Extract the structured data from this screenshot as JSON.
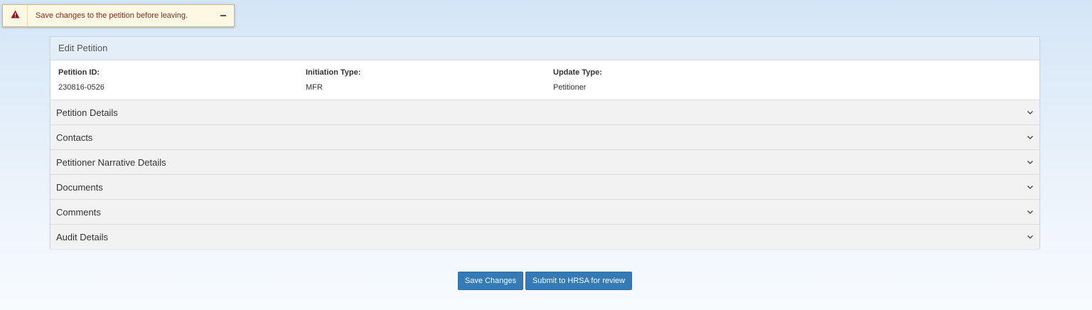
{
  "alert": {
    "message": "Save changes to the petition before leaving.",
    "icon": "warning-triangle-icon",
    "close_icon": "minimize-icon",
    "text_color": "#8a2a1a",
    "background": "#fcf8e3"
  },
  "panel": {
    "title": "Edit Petition",
    "fields": [
      {
        "label": "Petition ID:",
        "value": "230816-0526"
      },
      {
        "label": "Initiation Type:",
        "value": "MFR"
      },
      {
        "label": "Update Type:",
        "value": "Petitioner"
      }
    ],
    "sections": [
      {
        "title": "Petition Details"
      },
      {
        "title": "Contacts"
      },
      {
        "title": "Petitioner Narrative Details"
      },
      {
        "title": "Documents"
      },
      {
        "title": "Comments"
      },
      {
        "title": "Audit Details"
      }
    ]
  },
  "actions": {
    "save_label": "Save Changes",
    "submit_label": "Submit to HRSA for review",
    "button_color": "#337ab7"
  }
}
